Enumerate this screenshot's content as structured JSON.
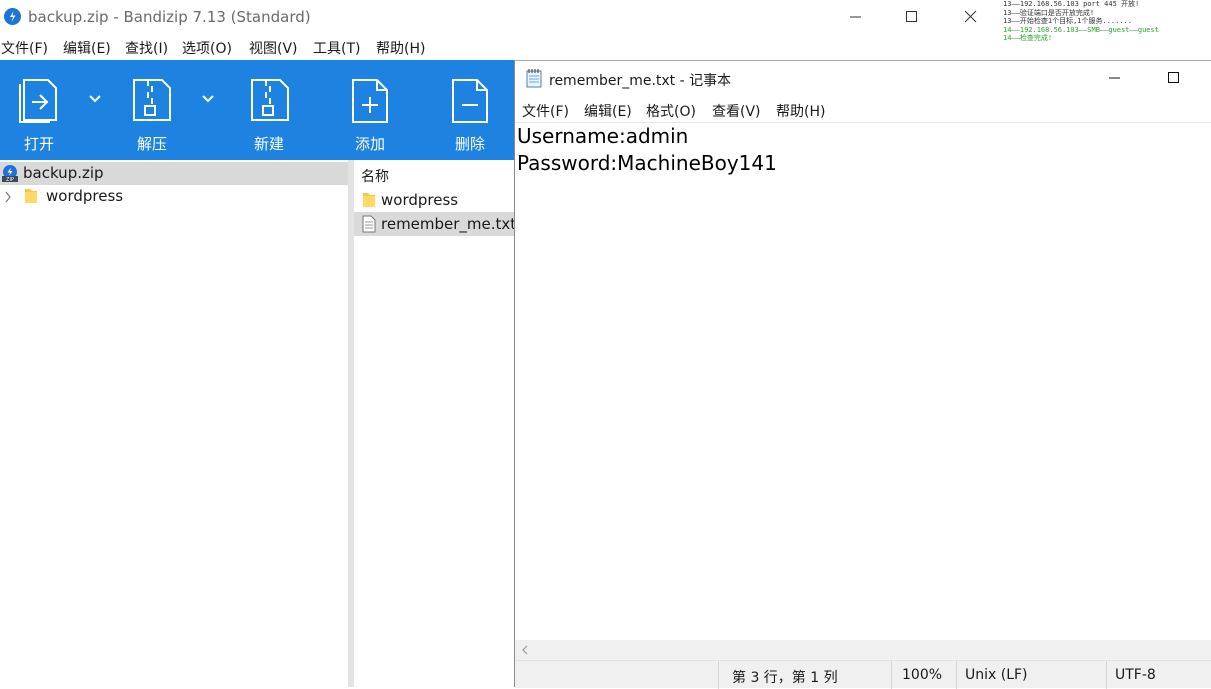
{
  "bandizip": {
    "title": "backup.zip - Bandizip 7.13 (Standard)",
    "menu": [
      "文件(F)",
      "编辑(E)",
      "查找(I)",
      "选项(O)",
      "视图(V)",
      "工具(T)",
      "帮助(H)"
    ],
    "toolbar": {
      "open": "打开",
      "extract": "解压",
      "new": "新建",
      "add": "添加",
      "delete": "删除"
    },
    "tree": {
      "root": "backup.zip",
      "child": "wordpress"
    },
    "list": {
      "header": "名称",
      "items": [
        "wordpress",
        "remember_me.txt"
      ]
    },
    "colors": {
      "toolbar": "#1d82e0",
      "selection": "#d9d9d9"
    }
  },
  "console": {
    "lines": [
      "13——192.168.56.103 port 445 开放!",
      "13——验证端口是否开放完成!",
      "13——开始检查1个目标,1个服务.......",
      "14——192.168.56.103——SMB——guest——guest",
      "14——检查完成!"
    ]
  },
  "notepad": {
    "title": "remember_me.txt - 记事本",
    "menu": [
      "文件(F)",
      "编辑(E)",
      "格式(O)",
      "查看(V)",
      "帮助(H)"
    ],
    "content": [
      "Username:admin",
      "Password:MachineBoy141"
    ],
    "status": {
      "position": "第 3 行，第 1 列",
      "zoom": "100%",
      "line_ending": "Unix (LF)",
      "encoding": "UTF-8"
    }
  }
}
